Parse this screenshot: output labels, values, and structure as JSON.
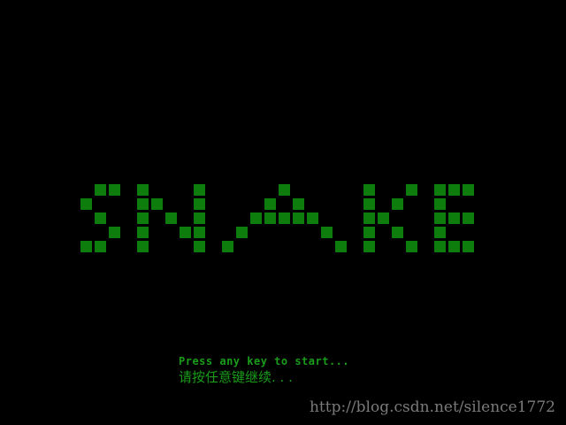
{
  "title": "SNAKE",
  "colors": {
    "background": "#000000",
    "block": "#0d7d0d",
    "prompt": "#1a9c1a",
    "watermark": "#7a7a7a"
  },
  "start_screen": {
    "press_key_en": "Press any key to start...",
    "press_key_cn": "请按任意键继续. . ."
  },
  "watermark": "http://blog.csdn.net/silence1772"
}
